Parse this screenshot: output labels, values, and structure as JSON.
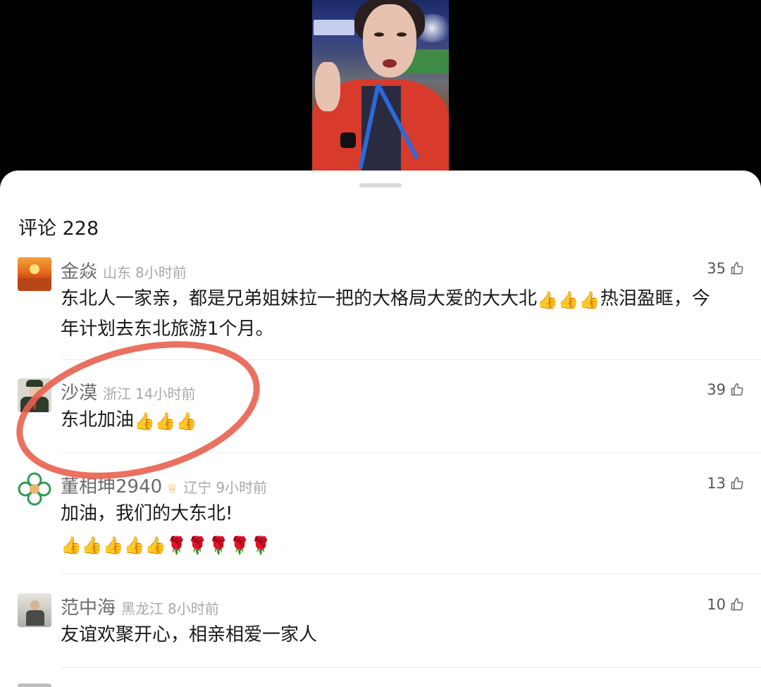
{
  "sheet": {
    "title": "评论 228"
  },
  "comments": [
    {
      "username": "金焱",
      "location": "山东",
      "time": "8小时前",
      "likes": "35",
      "text": "东北人一家亲，都是兄弟姐妹拉一把的大格局大爱的大大北",
      "text_suffix": "热泪盈眶，今年计划去东北旅游1个月。",
      "avatar": "sunset-avatar"
    },
    {
      "username": "沙漠",
      "location": "浙江",
      "time": "14小时前",
      "likes": "39",
      "text": "东北加油",
      "avatar": "military-avatar"
    },
    {
      "username": "董相坤2940",
      "location": "辽宁",
      "time": "9小时前",
      "likes": "13",
      "text": "加油，我们的大东北!",
      "avatar": "flower-logo-avatar"
    },
    {
      "username": "范中海",
      "location": "黑龙江",
      "time": "8小时前",
      "likes": "10",
      "text": "友谊欢聚开心，相亲相爱一家人",
      "avatar": "man-photo-avatar"
    }
  ],
  "icons": {
    "like": "thumbs-up-outline-icon",
    "thumb_emoji": "👍",
    "rose_emoji": "🌹"
  },
  "colors": {
    "annotation": "#e8614f",
    "like_count": "#555555",
    "username": "#6b6b6b",
    "meta": "#a8a8a8"
  }
}
